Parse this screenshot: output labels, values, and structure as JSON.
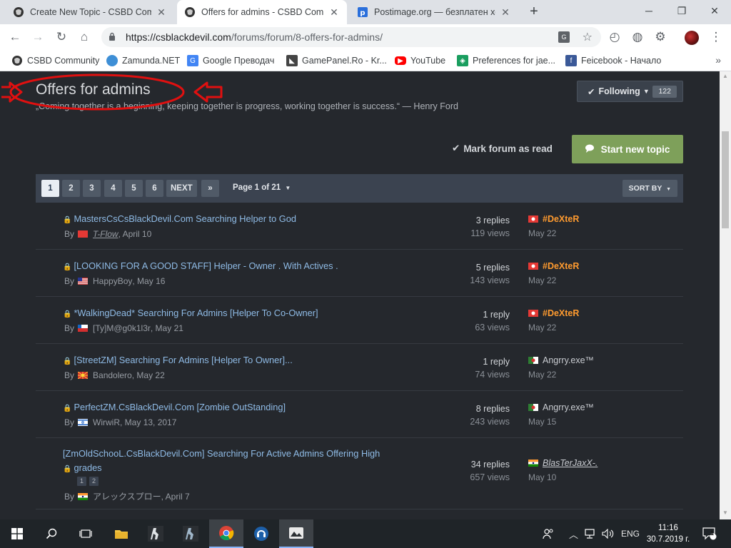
{
  "browser": {
    "tabs": [
      {
        "label": "Create New Topic - CSBD Commu",
        "active": false
      },
      {
        "label": "Offers for admins - CSBD Commu",
        "active": true
      },
      {
        "label": "Postimage.org — безплатен хост",
        "active": false
      }
    ],
    "url_host": "https://csblackdevil.com",
    "url_path": "/forums/forum/8-offers-for-admins/",
    "new_tab": "+",
    "bookmarks": [
      "CSBD Community",
      "Zamunda.NET",
      "Google Преводач",
      "GamePanel.Ro - Kr...",
      "YouTube",
      "Preferences for jae...",
      "Feicebook - Начало"
    ],
    "more": "»"
  },
  "forum": {
    "title": "Offers for admins",
    "description": "„Coming together is a beginning, keeping together is progress, working together is success.“ — Henry Ford",
    "follow_label": "Following",
    "follow_count": "122",
    "mark_read_label": "Mark forum as read",
    "new_topic_label": "Start new topic"
  },
  "pagination": {
    "pages": [
      "1",
      "2",
      "3",
      "4",
      "5",
      "6"
    ],
    "next_label": "NEXT",
    "last_label": "»",
    "page_info": "Page 1 of 21",
    "sort_label": "SORT BY"
  },
  "topics": [
    {
      "title": "MastersCsCsBlackDevil.Com Searching Helper to God",
      "by": "By",
      "author": "T-Flow",
      "date": ", April 10",
      "replies": "3 replies",
      "views": "119 views",
      "last_user": "#DeXteR",
      "last_date": "May 22"
    },
    {
      "title": "[LOOKING FOR A GOOD STAFF] Helper - Owner . With Actives .",
      "by": "By",
      "author": "HappyBoy",
      "date": ", May 16",
      "replies": "5 replies",
      "views": "143 views",
      "last_user": "#DeXteR",
      "last_date": "May 22"
    },
    {
      "title": "*WalkingDead* Searching For Admins [Helper To Co-Owner]",
      "by": "By",
      "author": "[Ty]M@g0k1l3r",
      "date": ", May 21",
      "replies": "1 reply",
      "views": "63 views",
      "last_user": "#DeXteR",
      "last_date": "May 22"
    },
    {
      "title": "[StreetZM] Searching For Admins [Helper To Owner]...",
      "by": "By",
      "author": "Bandolero",
      "date": ", May 22",
      "replies": "1 reply",
      "views": "74 views",
      "last_user": "Angrry.exe™",
      "last_date": "May 22"
    },
    {
      "title": "PerfectZM.CsBlackDevil.Com [Zombie OutStanding]",
      "by": "By",
      "author": "WirwiR",
      "date": ", May 13, 2017",
      "replies": "8 replies",
      "views": "243 views",
      "last_user": "Angrry.exe™",
      "last_date": "May 15"
    },
    {
      "title_line1": "[ZmOldSchooL.CsBlackDevil.Com] Searching For Active Admins Offering High",
      "title_line2": "grades",
      "mini_pages": [
        "1",
        "2"
      ],
      "by": "By",
      "author": "アレックスプロー",
      "date": ", April 7",
      "replies": "34 replies",
      "views": "657 views",
      "last_user": "BlasTerJaxX-.",
      "last_date": "May 10"
    }
  ],
  "taskbar": {
    "lang": "ENG",
    "time": "11:16",
    "date": "30.7.2019 г.",
    "notif_count": "1"
  },
  "colors": {
    "accent_green": "#7ea05a",
    "link_blue": "#8fbbe6",
    "staff_orange": "#ff9b2f",
    "annotation_red": "#e01010"
  }
}
